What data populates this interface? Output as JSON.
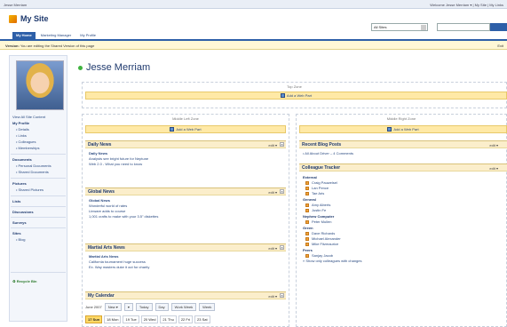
{
  "top_bar": {
    "left_text": "Jesse Merriam",
    "right_text": "Welcome Jesse Merriam ▾ | My Site | My Links"
  },
  "site": {
    "title": "My Site"
  },
  "search": {
    "scope": "All Sites"
  },
  "tabs": [
    {
      "label": "My Home",
      "selected": true
    },
    {
      "label": "Marketing Manager",
      "selected": false
    },
    {
      "label": "My Profile",
      "selected": false
    }
  ],
  "version_bar": {
    "label": "Version:",
    "text": "You are editing the Shared Version of this page",
    "right": "Exit"
  },
  "nav": {
    "view_all": "View All Site Content",
    "my_profile": "My Profile",
    "profile_items": [
      "Details",
      "Links",
      "Colleagues",
      "Memberships"
    ],
    "documents": "Documents",
    "document_items": [
      "Personal Documents",
      "Shared Documents"
    ],
    "pictures": "Pictures",
    "picture_items": [
      "Shared Pictures"
    ],
    "lists": "Lists",
    "discussions": "Discussions",
    "surveys": "Surveys",
    "sites": "Sites",
    "site_items": [
      "Blog"
    ],
    "recycle_bin": "Recycle Bin"
  },
  "owner": {
    "name": "Jesse Merriam"
  },
  "zones": {
    "top": "Top Zone",
    "middle_left": "Middle Left Zone",
    "middle_right": "Middle Right Zone",
    "add_web_part": "Add a Web Part"
  },
  "web_parts": {
    "edit_label": "edit ▾",
    "close_label": "×",
    "daily_news": {
      "title": "Daily News",
      "headline": "Daily News",
      "lines": [
        "Analysts see bright future for Neptune",
        "Web 2.0 - What you need to know"
      ]
    },
    "global_news": {
      "title": "Global News",
      "headline": "Global News",
      "lines": [
        "Wonderful world of rates",
        "Linware adds to course",
        "1,001 crafts to make with your 3.5\" diskettes"
      ]
    },
    "martial_arts": {
      "title": "Martial Arts News",
      "headline": "Martial Arts News",
      "lines": [
        "California tournament huge success",
        "Ex. Way masters duke it out for charity"
      ]
    },
    "calendar": {
      "title": "My Calendar",
      "month": "June 2007",
      "buttons": [
        "New ▾",
        "▾",
        "Today",
        "Day",
        "Work Week",
        "Week"
      ],
      "days": [
        "17 Sun",
        "18 Mon",
        "19 Tue",
        "20 Wed",
        "21 Thu",
        "22 Fri",
        "23 Sat"
      ],
      "today_index": 0
    },
    "recent_blog": {
      "title": "Recent Blog Posts",
      "links": "• All About Driver – 4 Comments"
    },
    "colleague_tracker": {
      "title": "Colleague Tracker",
      "groups": [
        {
          "name": "External",
          "people": [
            "Craig Pauwelsel",
            "Lan Pence",
            "Tae Aris"
          ]
        },
        {
          "name": "General",
          "people": [
            "Amy Alberts",
            "Justin Fe"
          ]
        },
        {
          "name": "Nephew Computer",
          "people": [
            "Peter Mullen"
          ]
        },
        {
          "name": "Green",
          "people": [
            "Dave Richards",
            "Michael Alexander",
            "Mike Fitzmaurice"
          ]
        },
        {
          "name": "Peers",
          "people": [
            "Sanjay Jacob"
          ]
        }
      ],
      "footer": "» Show only colleagues with changes"
    }
  }
}
